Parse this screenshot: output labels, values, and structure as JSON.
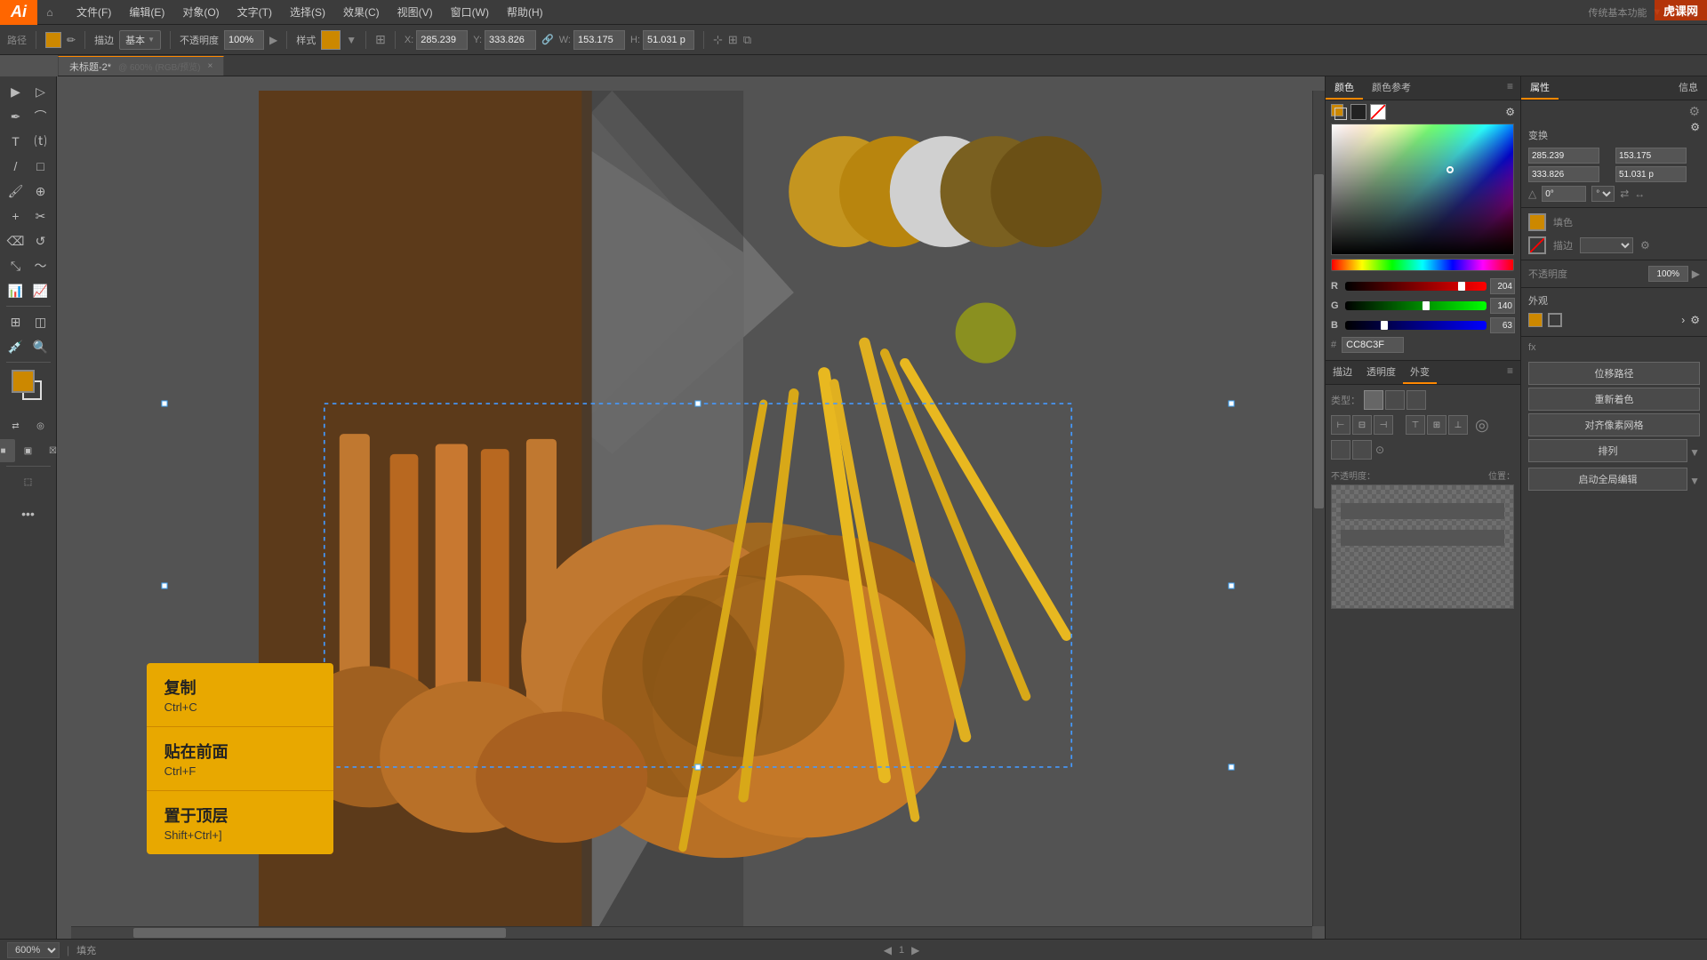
{
  "app": {
    "logo": "Ai",
    "title": "Adobe Illustrator"
  },
  "menu": {
    "items": [
      "文件(F)",
      "编辑(E)",
      "对象(O)",
      "文字(T)",
      "选择(S)",
      "效果(C)",
      "视图(V)",
      "窗口(W)",
      "帮助(H)"
    ]
  },
  "toolbar": {
    "tool_label": "路径",
    "fill_color": "#cc8800",
    "stroke_label": "描边",
    "stroke_width": "基本",
    "opacity_label": "不透明度",
    "opacity_value": "100%",
    "style_label": "样式",
    "x_label": "X:",
    "x_value": "285.239",
    "y_label": "Y:",
    "y_value": "333.826",
    "w_label": "W:",
    "w_value": "153.175",
    "h_label": "H:",
    "h_value": "51.031 p"
  },
  "tab": {
    "title": "未标题-2*",
    "mode": "600% (RGB/预览)",
    "close": "×"
  },
  "canvas": {
    "zoom": "600%",
    "mode": "填充"
  },
  "color_panel": {
    "title": "颜色",
    "title2": "颜色参考",
    "r_value": "204",
    "g_value": "140",
    "b_value": "63",
    "hex_value": "CC8C3F",
    "r_percent": "80",
    "g_percent": "55",
    "b_percent": "25"
  },
  "transparency_panel": {
    "title": "描边",
    "title2": "透明度",
    "title3": "外变",
    "opacity_label": "不透明度：",
    "position_label": "位置：",
    "type_label": "类型："
  },
  "attribute_panel": {
    "title": "属性",
    "title2": "信息",
    "transform_title": "变换",
    "x_value": "285.239",
    "y_value": "153.175",
    "w_value": "333.826",
    "h_value": "51.031 p",
    "angle_value": "0°",
    "fill_label": "填色",
    "stroke_label": "描边",
    "opacity_label": "不透明度",
    "opacity_value": "100%",
    "appearance_title": "外观"
  },
  "quick_actions": {
    "btn1": "位移路径",
    "btn2": "重新着色",
    "btn3": "对齐像素网格",
    "btn4": "排列",
    "btn5": "启动全局编辑"
  },
  "context_menu": {
    "items": [
      {
        "title": "复制",
        "shortcut": "Ctrl+C"
      },
      {
        "title": "贴在前面",
        "shortcut": "Ctrl+F"
      },
      {
        "title": "置于顶层",
        "shortcut": "Shift+Ctrl+]"
      }
    ]
  },
  "status_bar": {
    "zoom": "600%",
    "mode": "填充"
  },
  "watermark": "虎课网"
}
